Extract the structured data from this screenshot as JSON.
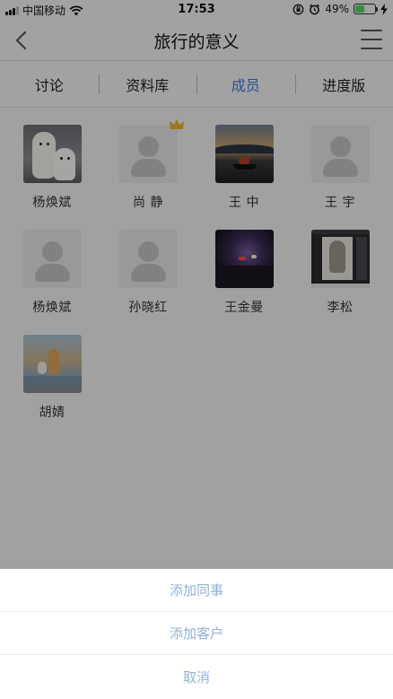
{
  "status_bar": {
    "carrier": "中国移动",
    "time": "17:53",
    "battery_percent": "49%",
    "battery_level": 0.49,
    "icons": [
      "signal-icon",
      "wifi-icon",
      "orientation-lock-icon",
      "alarm-icon",
      "battery-icon",
      "charging-icon"
    ]
  },
  "nav": {
    "title": "旅行的意义",
    "back_icon": "chevron-left-icon",
    "menu_icon": "hamburger-menu-icon"
  },
  "tabs": [
    {
      "label": "讨论",
      "active": false
    },
    {
      "label": "资料库",
      "active": false
    },
    {
      "label": "成员",
      "active": true
    },
    {
      "label": "进度版",
      "active": false
    }
  ],
  "members": [
    {
      "name": "杨焕斌",
      "avatar": "photo-dogs"
    },
    {
      "name": "尚 静",
      "avatar": "placeholder",
      "badge": "crown-icon"
    },
    {
      "name": "王 中",
      "avatar": "photo-lake"
    },
    {
      "name": "王 宇",
      "avatar": "placeholder"
    },
    {
      "name": "杨焕斌",
      "avatar": "placeholder"
    },
    {
      "name": "孙晓红",
      "avatar": "placeholder"
    },
    {
      "name": "王金曼",
      "avatar": "photo-night"
    },
    {
      "name": "李松",
      "avatar": "photo-sketch"
    },
    {
      "name": "胡婧",
      "avatar": "photo-painting"
    }
  ],
  "action_sheet": {
    "add_colleague": "添加同事",
    "add_customer": "添加客户",
    "cancel": "取消"
  },
  "colors": {
    "accent": "#3f7ad8",
    "action_text": "#8fb1d8",
    "overlay": "rgba(0,0,0,0.34)",
    "battery_fill": "#4cd964",
    "crown": "#f0b429"
  }
}
